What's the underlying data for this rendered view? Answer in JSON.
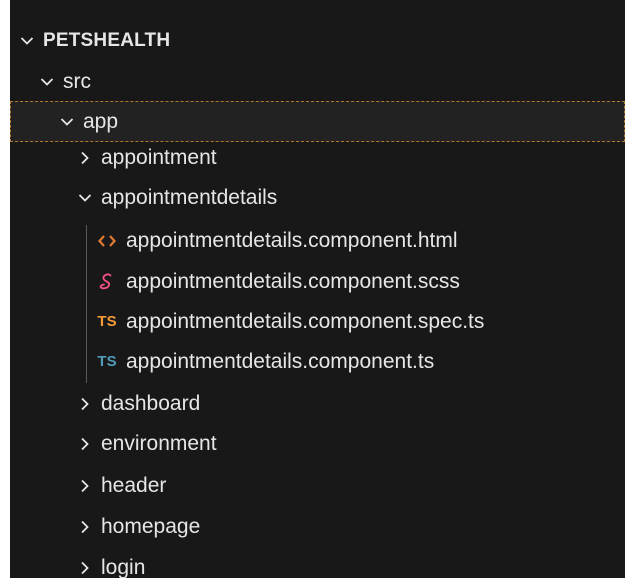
{
  "explorer": {
    "root": {
      "label": "PETSHEALTH",
      "expanded": true
    },
    "src": {
      "label": "src",
      "expanded": true
    },
    "app": {
      "label": "app",
      "expanded": true
    },
    "folders": {
      "appointment": {
        "label": "appointment",
        "expanded": false
      },
      "appointmentdetails": {
        "label": "appointmentdetails",
        "expanded": true
      },
      "dashboard": {
        "label": "dashboard",
        "expanded": false
      },
      "environment": {
        "label": "environment",
        "expanded": false
      },
      "header": {
        "label": "header",
        "expanded": false
      },
      "homepage": {
        "label": "homepage",
        "expanded": false
      },
      "login": {
        "label": "login",
        "expanded": false
      }
    },
    "files": [
      {
        "name": "appointmentdetails.component.html",
        "icon": "html-icon",
        "glyph": "<>",
        "color": "#e37933"
      },
      {
        "name": "appointmentdetails.component.scss",
        "icon": "sass-icon",
        "glyph": "ℓ",
        "color": "#f55385"
      },
      {
        "name": "appointmentdetails.component.spec.ts",
        "icon": "typescript-spec-icon",
        "glyph": "TS",
        "color": "#f69a3a"
      },
      {
        "name": "appointmentdetails.component.ts",
        "icon": "typescript-icon",
        "glyph": "TS",
        "color": "#519aba"
      }
    ]
  },
  "colors": {
    "background": "#181818",
    "text": "#e6e6e6",
    "selection_border": "#b07a2e",
    "indent_guide": "#5a5a5a"
  }
}
